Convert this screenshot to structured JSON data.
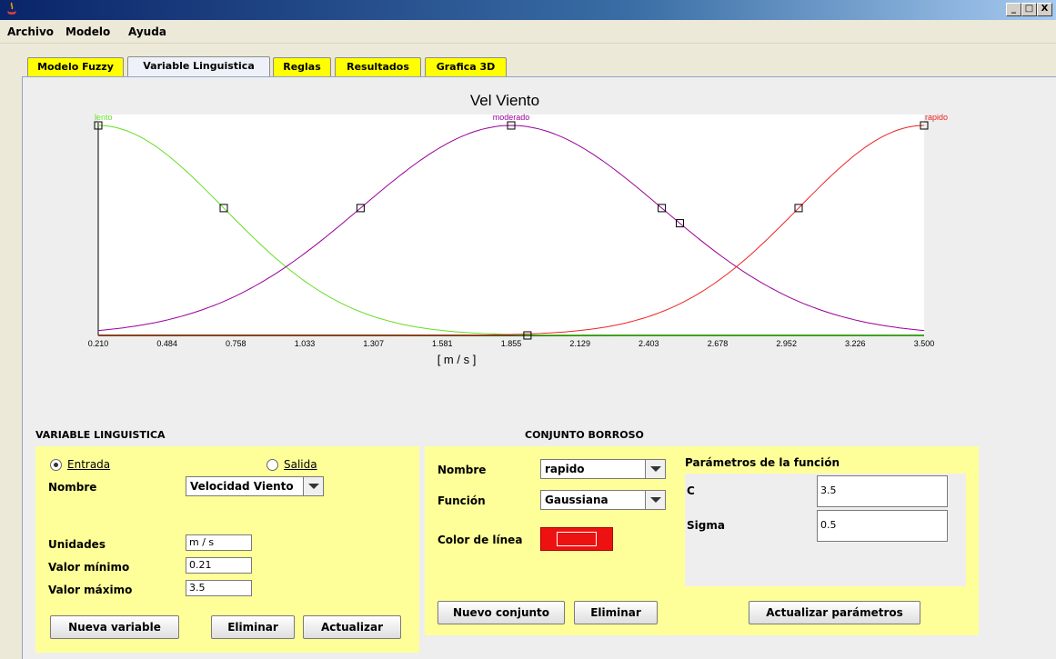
{
  "window": {
    "minimize": "_",
    "maximize": "□",
    "close": "X"
  },
  "menu": [
    "Archivo",
    "Modelo",
    "Ayuda"
  ],
  "tabs": [
    "Modelo Fuzzy",
    "Variable Linguistica",
    "Reglas",
    "Resultados",
    "Grafica 3D"
  ],
  "active_tab": "Variable Linguistica",
  "chart_data": {
    "type": "line",
    "title": "Vel Viento",
    "xlabel": "[ m / s ]",
    "xlim": [
      0.21,
      3.5
    ],
    "ylim": [
      0,
      1
    ],
    "x_ticks": [
      "0.210",
      "0.484",
      "0.758",
      "1.033",
      "1.307",
      "1.581",
      "1.855",
      "2.129",
      "2.403",
      "2.678",
      "2.952",
      "3.226",
      "3.500"
    ],
    "series": [
      {
        "name": "lento",
        "function": "gaussian",
        "c": 0.21,
        "sigma": 0.5,
        "color": "#66dd22"
      },
      {
        "name": "moderado",
        "function": "gaussian",
        "c": 1.855,
        "sigma": 0.6,
        "color": "#990099"
      },
      {
        "name": "rapido",
        "function": "gaussian",
        "c": 3.5,
        "sigma": 0.5,
        "color": "#ee2222"
      }
    ]
  },
  "variable": {
    "section_title": "VARIABLE LINGUISTICA",
    "entrada_label": "Entrada",
    "salida_label": "Salida",
    "selected": "Entrada",
    "nombre_label": "Nombre",
    "nombre_value": "Velocidad Viento",
    "unidades_label": "Unidades",
    "unidades_value": "m / s",
    "min_label": "Valor mínimo",
    "min_value": "0.21",
    "max_label": "Valor máximo",
    "max_value": "3.5",
    "btn_new": "Nueva variable",
    "btn_delete": "Eliminar",
    "btn_update": "Actualizar"
  },
  "conjunto": {
    "section_title": "CONJUNTO BORROSO",
    "nombre_label": "Nombre",
    "nombre_value": "rapido",
    "funcion_label": "Función",
    "funcion_value": "Gaussiana",
    "color_label": "Color de línea",
    "line_color": "#ee1111",
    "params_title": "Parámetros de la función",
    "param_c_label": "C",
    "param_c_value": "3.5",
    "param_sigma_label": "Sigma",
    "param_sigma_value": "0.5",
    "btn_new": "Nuevo conjunto",
    "btn_delete": "Eliminar",
    "btn_update": "Actualizar parámetros"
  }
}
